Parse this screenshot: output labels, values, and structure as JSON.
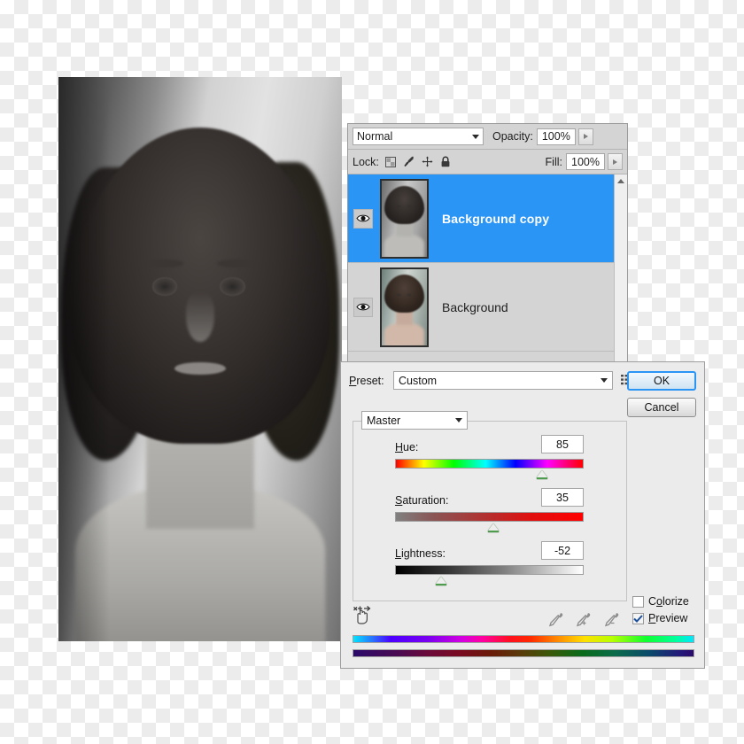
{
  "layers_panel": {
    "blend_mode": "Normal",
    "opacity_label": "Opacity:",
    "opacity_value": "100%",
    "lock_label": "Lock:",
    "fill_label": "Fill:",
    "fill_value": "100%",
    "lock_icons": [
      "transparency-lock-icon",
      "pixels-lock-icon",
      "position-lock-icon",
      "all-lock-icon"
    ],
    "layers": [
      {
        "name": "Background  copy",
        "selected": true,
        "visible": true
      },
      {
        "name": "Background",
        "selected": false,
        "visible": true
      }
    ]
  },
  "hue_sat_dialog": {
    "preset_label": "Preset:",
    "preset_value": "Custom",
    "preset_menu_icon": "preset-menu-icon",
    "ok_label": "OK",
    "cancel_label": "Cancel",
    "channel_value": "Master",
    "sliders": [
      {
        "label": "Hue:",
        "value": "85",
        "knob_pct": 78
      },
      {
        "label": "Saturation:",
        "value": "35",
        "knob_pct": 52
      },
      {
        "label": "Lightness:",
        "value": "-52",
        "knob_pct": 24
      }
    ],
    "targeted_adjust_icon": "on-image-adjust-hand-icon",
    "eyedroppers": [
      "eyedropper-icon",
      "eyedropper-plus-icon",
      "eyedropper-minus-icon"
    ],
    "colorize_label": "Colorize",
    "colorize_checked": false,
    "preview_label": "Preview",
    "preview_checked": true
  },
  "colors": {
    "selection_blue": "#2a95f5",
    "panel_gray": "#d4d4d4",
    "dialog_gray": "#ebebeb"
  }
}
